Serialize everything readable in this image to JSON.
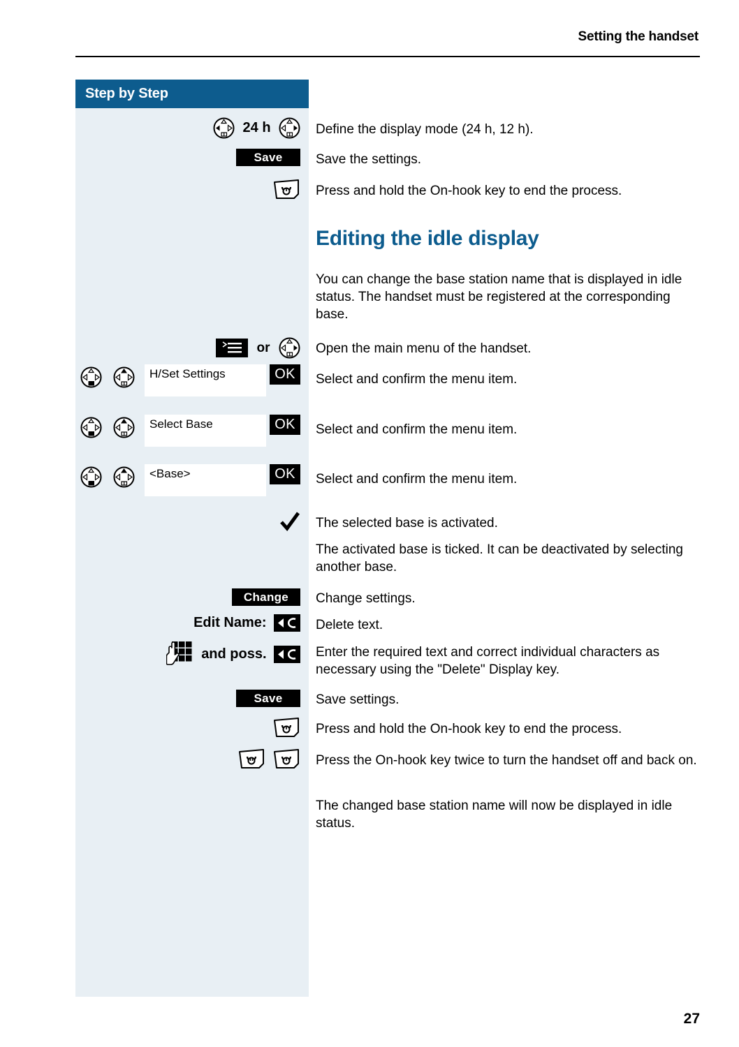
{
  "document": {
    "running_head": "Setting the handset",
    "page_number": "27"
  },
  "step_panel": {
    "header_label": "Step by Step"
  },
  "section": {
    "heading": "Editing the idle display",
    "intro": "You can change the base station name that is displayed in idle status. The handset must be registered at the corresponding base."
  },
  "labels": {
    "time_mode": "24 h",
    "or": "or",
    "edit_name": "Edit Name:",
    "and_poss": "and poss.",
    "ok": "OK",
    "save": "Save",
    "change": "Change",
    "delete_key": "C"
  },
  "menu_items": {
    "handset_settings": "H/Set Settings",
    "select_base": "Select Base",
    "base_placeholder": "<Base>"
  },
  "steps": [
    {
      "id": "define-display-mode",
      "text": "Define the display mode (24 h, 12 h)."
    },
    {
      "id": "save-the-settings",
      "text": "Save the settings."
    },
    {
      "id": "end-process-1",
      "text": "Press and hold the On-hook key to end the process."
    },
    {
      "id": "open-main-menu",
      "text": "Open the main menu of the handset."
    },
    {
      "id": "select-confirm-1",
      "text": "Select and confirm the menu item."
    },
    {
      "id": "select-confirm-2",
      "text": "Select and confirm the menu item."
    },
    {
      "id": "select-confirm-3",
      "text": "Select and confirm the menu item."
    },
    {
      "id": "base-activated",
      "text": "The selected base is activated."
    },
    {
      "id": "base-ticked",
      "text": "The activated base is ticked. It can be deactivated by selecting another base."
    },
    {
      "id": "change-settings",
      "text": "Change settings."
    },
    {
      "id": "delete-text",
      "text": "Delete text."
    },
    {
      "id": "enter-text",
      "text": "Enter the required text and correct individual characters as necessary using the \"Delete\" Display key."
    },
    {
      "id": "save-settings",
      "text": "Save settings."
    },
    {
      "id": "end-process-2",
      "text": "Press and hold the On-hook key to end the process."
    },
    {
      "id": "press-twice",
      "text": "Press the On-hook key twice to turn the handset off and back on."
    },
    {
      "id": "name-displayed",
      "text": "The changed base station name will now be displayed in idle status."
    }
  ],
  "colors": {
    "brand_blue": "#0d5c8e",
    "panel_blue": "#e8eff4",
    "black": "#000000"
  },
  "icons": {
    "nav_left": "nav-key-left-icon",
    "nav_right": "nav-key-right-icon",
    "nav_down": "nav-key-down-icon",
    "nav_up": "nav-key-up-icon",
    "menu": "menu-key-icon",
    "onhook": "on-hook-key-icon",
    "checkmark": "checkmark-icon",
    "keypad": "keypad-hand-icon",
    "delete": "delete-key-icon"
  }
}
